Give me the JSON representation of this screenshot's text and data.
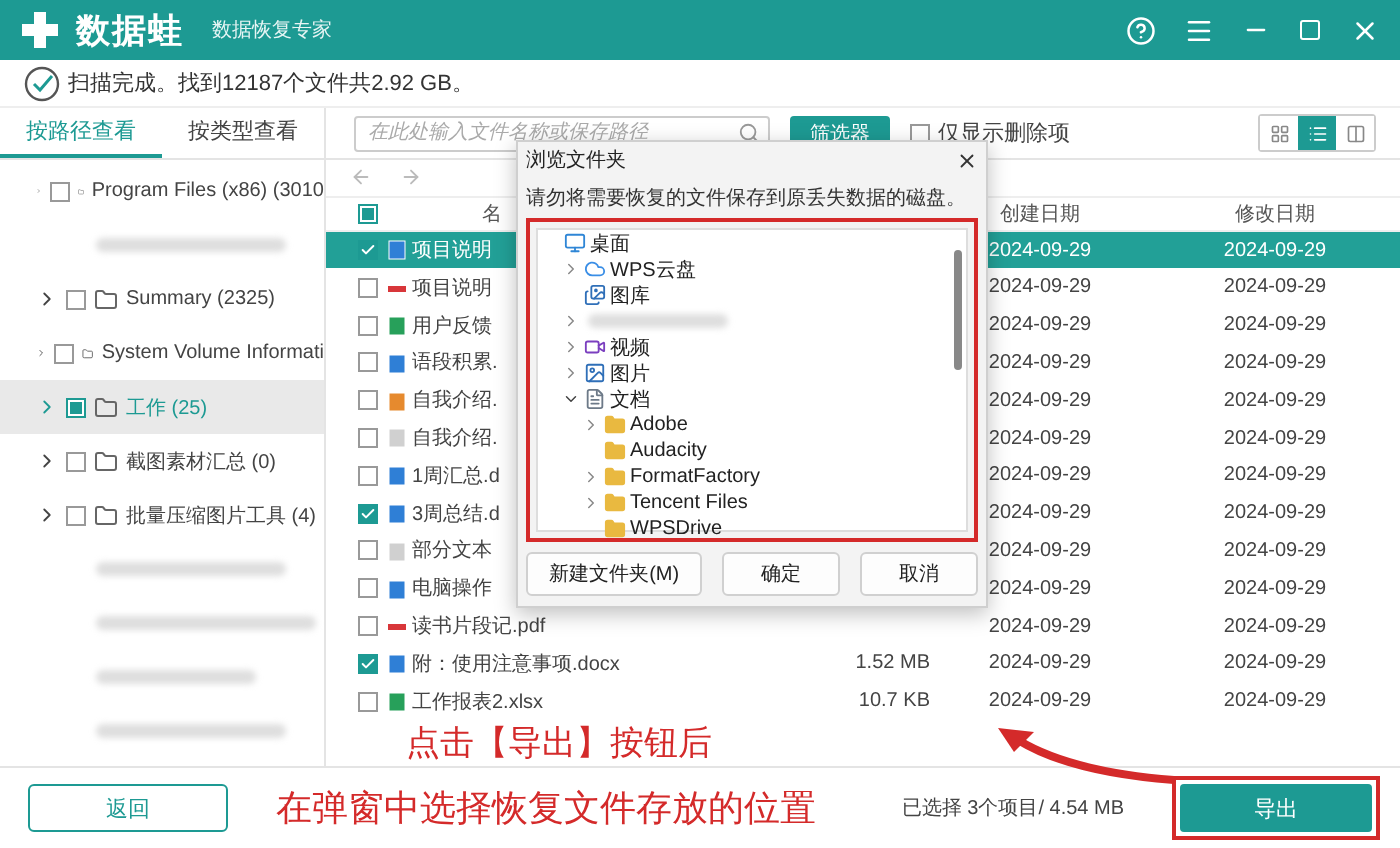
{
  "app": {
    "name": "数据蛙",
    "subtitle": "数据恢复专家"
  },
  "scan_status": "扫描完成。找到12187个文件共2.92 GB。",
  "tabs": [
    {
      "label": "按路径查看",
      "selected": true
    },
    {
      "label": "按类型查看",
      "selected": false
    }
  ],
  "search": {
    "placeholder": "在此处输入文件名称或保存路径"
  },
  "filter_button": "筛选器",
  "deleted_only": {
    "label": "仅显示删除项",
    "checked": false
  },
  "view_modes": [
    {
      "kind": "grid",
      "selected": false
    },
    {
      "kind": "list",
      "selected": true
    },
    {
      "kind": "columns",
      "selected": false
    }
  ],
  "sidebar": {
    "items": [
      {
        "kind": "folder",
        "label": "Program Files (x86) (3010",
        "checked": false,
        "partially_checked": false,
        "selected": false
      },
      {
        "kind": "blurred",
        "selected": false
      },
      {
        "kind": "folder",
        "label": "Summary (2325)",
        "checked": false,
        "partially_checked": false,
        "selected": false
      },
      {
        "kind": "folder",
        "label": "System Volume Informati",
        "checked": false,
        "partially_checked": false,
        "selected": false
      },
      {
        "kind": "folder",
        "label": "工作 (25)",
        "checked": false,
        "partially_checked": true,
        "selected": true
      },
      {
        "kind": "folder",
        "label": "截图素材汇总 (0)",
        "checked": false,
        "partially_checked": false,
        "selected": false
      },
      {
        "kind": "folder",
        "label": "批量压缩图片工具 (4)",
        "checked": false,
        "partially_checked": false,
        "selected": false
      },
      {
        "kind": "blurred",
        "selected": false
      },
      {
        "kind": "blurred",
        "selected": false
      },
      {
        "kind": "blurred",
        "selected": false
      },
      {
        "kind": "blurred",
        "selected": false
      }
    ]
  },
  "table": {
    "header": {
      "checked": false,
      "partially_checked": true
    },
    "columns": [
      "名",
      "创建日期",
      "修改日期"
    ],
    "rows": [
      {
        "kind": "word",
        "name": "项目说明",
        "created": "2024-09-29",
        "modified": "2024-09-29",
        "checked": true,
        "selected": true
      },
      {
        "kind": "pdf",
        "name": "项目说明",
        "created": "2024-09-29",
        "modified": "2024-09-29",
        "checked": false,
        "selected": false
      },
      {
        "kind": "excel",
        "name": "用户反馈",
        "created": "2024-09-29",
        "modified": "2024-09-29",
        "checked": false,
        "selected": false
      },
      {
        "kind": "word",
        "name": "语段积累.",
        "created": "2024-09-29",
        "modified": "2024-09-29",
        "checked": false,
        "selected": false
      },
      {
        "kind": "ppt",
        "name": "自我介绍.",
        "created": "2024-09-29",
        "modified": "2024-09-29",
        "checked": false,
        "selected": false
      },
      {
        "kind": "text",
        "name": "自我介绍.",
        "created": "2024-09-29",
        "modified": "2024-09-29",
        "checked": false,
        "selected": false
      },
      {
        "kind": "word",
        "name": "1周汇总.d",
        "created": "2024-09-29",
        "modified": "2024-09-29",
        "checked": false,
        "selected": false
      },
      {
        "kind": "word",
        "name": "3周总结.d",
        "created": "2024-09-29",
        "modified": "2024-09-29",
        "checked": true,
        "selected": false
      },
      {
        "kind": "text",
        "name": "部分文本",
        "created": "2024-09-29",
        "modified": "2024-09-29",
        "checked": false,
        "selected": false
      },
      {
        "kind": "word",
        "name": "电脑操作",
        "created": "2024-09-29",
        "modified": "2024-09-29",
        "checked": false,
        "selected": false
      },
      {
        "kind": "pdf",
        "name": "读书片段记.pdf",
        "created": "2024-09-29",
        "modified": "2024-09-29",
        "checked": false,
        "selected": false
      },
      {
        "kind": "word",
        "name": "附：使用注意事项.docx",
        "size": "1.52 MB",
        "created": "2024-09-29",
        "modified": "2024-09-29",
        "checked": true,
        "selected": false
      },
      {
        "kind": "excel",
        "name": "工作报表2.xlsx",
        "size": "10.7 KB",
        "created": "2024-09-29",
        "modified": "2024-09-29",
        "checked": false,
        "selected": false
      }
    ]
  },
  "dialog": {
    "title": "浏览文件夹",
    "message": "请勿将需要恢复的文件保存到原丢失数据的磁盘。",
    "tree": [
      {
        "kind": "desktop",
        "label": "桌面",
        "expandable": false,
        "children": [
          {
            "kind": "cloud",
            "label": "WPS云盘",
            "expandable": true,
            "expanded": false
          },
          {
            "kind": "gallery",
            "label": "图库",
            "expandable": false
          },
          {
            "kind": "blurred",
            "expandable": true,
            "expanded": false
          },
          {
            "kind": "video",
            "label": "视频",
            "expandable": true,
            "expanded": false
          },
          {
            "kind": "picture",
            "label": "图片",
            "expandable": true,
            "expanded": false
          },
          {
            "kind": "document",
            "label": "文档",
            "expandable": true,
            "expanded": true,
            "children": [
              {
                "kind": "folder",
                "label": "Adobe",
                "expandable": true,
                "expanded": false
              },
              {
                "kind": "folder",
                "label": "Audacity",
                "expandable": false
              },
              {
                "kind": "folder",
                "label": "FormatFactory",
                "expandable": true,
                "expanded": false
              },
              {
                "kind": "folder",
                "label": "Tencent Files",
                "expandable": true,
                "expanded": false
              },
              {
                "kind": "folder",
                "label": "WPSDrive",
                "expandable": false
              }
            ]
          }
        ]
      }
    ],
    "buttons": [
      "新建文件夹(M)",
      "确定",
      "取消"
    ]
  },
  "annotation": [
    "点击【导出】按钮后",
    "在弹窗中选择恢复文件存放的位置"
  ],
  "footer": {
    "back_button": "返回",
    "selection": "已选择 3个项目/ 4.54 MB",
    "export_button": "导出"
  }
}
